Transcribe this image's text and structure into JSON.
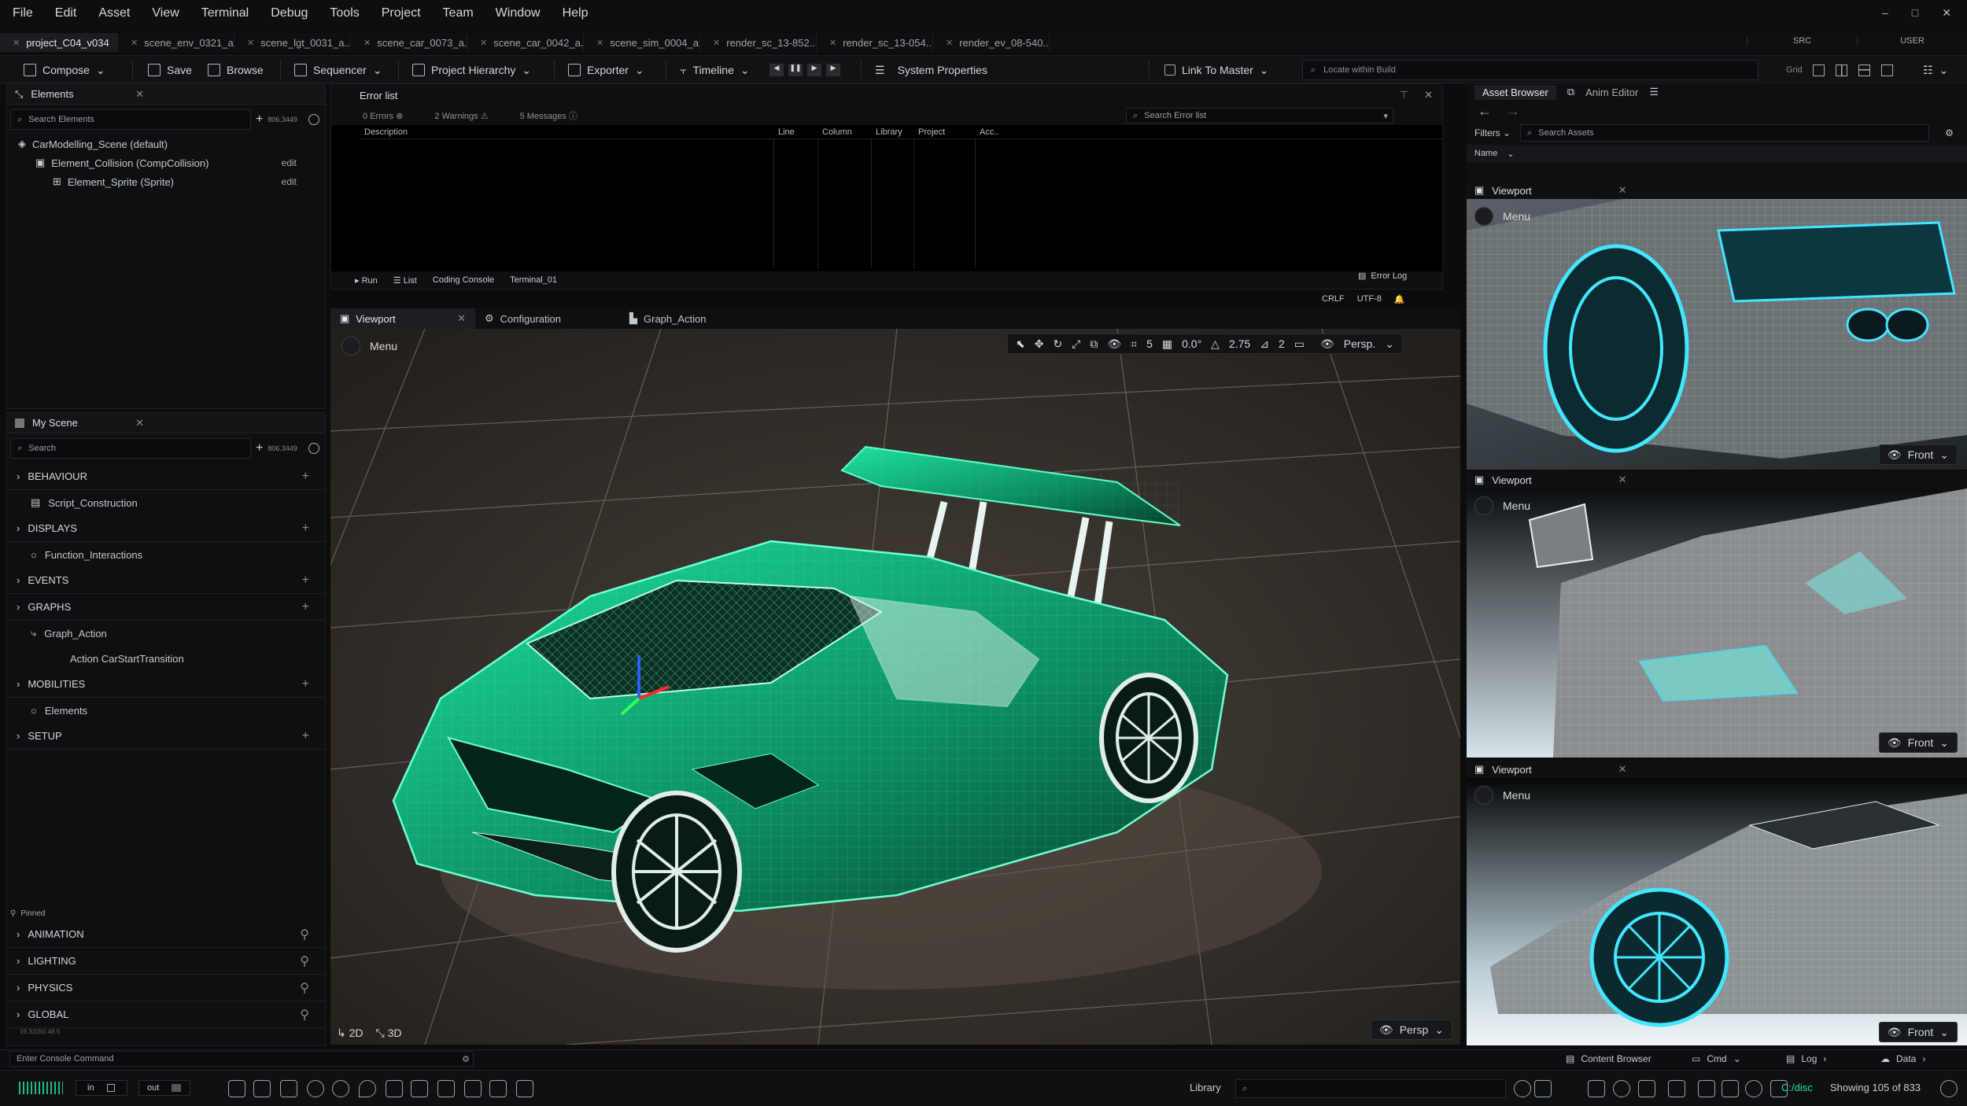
{
  "menubar": {
    "items": [
      "File",
      "Edit",
      "Asset",
      "View",
      "Terminal",
      "Debug",
      "Tools",
      "Project",
      "Team",
      "Window",
      "Help"
    ],
    "window_controls": [
      "–",
      "□",
      "✕"
    ]
  },
  "file_tabs": [
    {
      "label": "project_C04_v034",
      "active": true
    },
    {
      "label": "scene_env_0321_a..."
    },
    {
      "label": "scene_lgt_0031_a..."
    },
    {
      "label": "scene_car_0073_a..."
    },
    {
      "label": "scene_car_0042_a..."
    },
    {
      "label": "scene_sim_0004_a..."
    },
    {
      "label": "render_sc_13-852..."
    },
    {
      "label": "render_sc_13-054..."
    },
    {
      "label": "render_ev_08-540..."
    }
  ],
  "tab_right": {
    "src": "SRC",
    "user": "USER"
  },
  "toolbar": {
    "compose": "Compose",
    "save": "Save",
    "browse": "Browse",
    "sequencer": "Sequencer",
    "hierarchy": "Project Hierarchy",
    "exporter": "Exporter",
    "timeline": "Timeline",
    "system": "System Properties",
    "link": "Link To Master",
    "locate": "Locate within Build",
    "grid": "Grid"
  },
  "elements_panel": {
    "title": "Elements",
    "search": "Search Elements",
    "count": "806.3449",
    "tree": [
      {
        "label": "CarModelling_Scene (default)",
        "indent": 0,
        "edit": ""
      },
      {
        "label": "Element_Collision (CompCollision)",
        "indent": 1,
        "edit": "edit"
      },
      {
        "label": "Element_Sprite (Sprite)",
        "indent": 2,
        "edit": "edit"
      }
    ]
  },
  "error_panel": {
    "title": "Error list",
    "errors": "0 Errors",
    "warnings": "2 Warnings",
    "messages": "5 Messages",
    "search": "Search Error list",
    "columns": [
      "Description",
      "Line",
      "Column",
      "Library",
      "Project",
      "Acc.."
    ],
    "bottom_tabs": [
      "Run",
      "List",
      "Coding Console",
      "Terminal_01"
    ],
    "error_log": "Error Log",
    "crlf": "CRLF",
    "encoding": "UTF-8"
  },
  "scene_panel": {
    "title": "My Scene",
    "search": "Search",
    "count": "806.3449",
    "sections": [
      {
        "label": "BEHAVIOUR",
        "children": [
          "Script_Construction"
        ]
      },
      {
        "label": "DISPLAYS",
        "children": [
          "Function_Interactions"
        ]
      },
      {
        "label": "EVENTS",
        "children": []
      },
      {
        "label": "GRAPHS",
        "children": [
          "Graph_Action",
          "Action CarStartTransition"
        ]
      },
      {
        "label": "MOBILITIES",
        "children": [
          "Elements"
        ]
      },
      {
        "label": "SETUP",
        "children": []
      }
    ],
    "pinned": "Pinned",
    "pinned_sections": [
      "ANIMATION",
      "LIGHTING",
      "PHYSICS",
      "GLOBAL"
    ],
    "version": "19.31050.48.5"
  },
  "viewport": {
    "tabs": [
      "Viewport",
      "Configuration",
      "Graph_Action"
    ],
    "menu": "Menu",
    "grid_val": "5",
    "angle": "0.0°",
    "scale": "2.75",
    "cams": "2",
    "persp_top": "Persp.",
    "persp_bottom": "Persp",
    "mode_2d": "2D",
    "mode_3d": "3D"
  },
  "asset_browser": {
    "tabs": [
      "Asset Browser",
      "Anim Editor"
    ],
    "filters": "Filters",
    "search": "Search Assets",
    "sort": "Name",
    "viewports": [
      {
        "title": "Viewport",
        "menu": "Menu",
        "view": "Front"
      },
      {
        "title": "Viewport",
        "menu": "Menu",
        "view": "Front"
      },
      {
        "title": "Viewport",
        "menu": "Menu",
        "view": "Front"
      }
    ]
  },
  "statusbar": {
    "console": "Enter Console Command",
    "content_browser": "Content Browser",
    "cmd": "Cmd",
    "log": "Log",
    "data": "Data"
  },
  "bottombar": {
    "in": "in",
    "out": "out",
    "library": "Library",
    "path": "C:/disc",
    "showing": "Showing 105 of 833"
  },
  "colors": {
    "accent": "#2de0b0",
    "wire": "#19c98f",
    "bg": "#0b0c0d"
  }
}
